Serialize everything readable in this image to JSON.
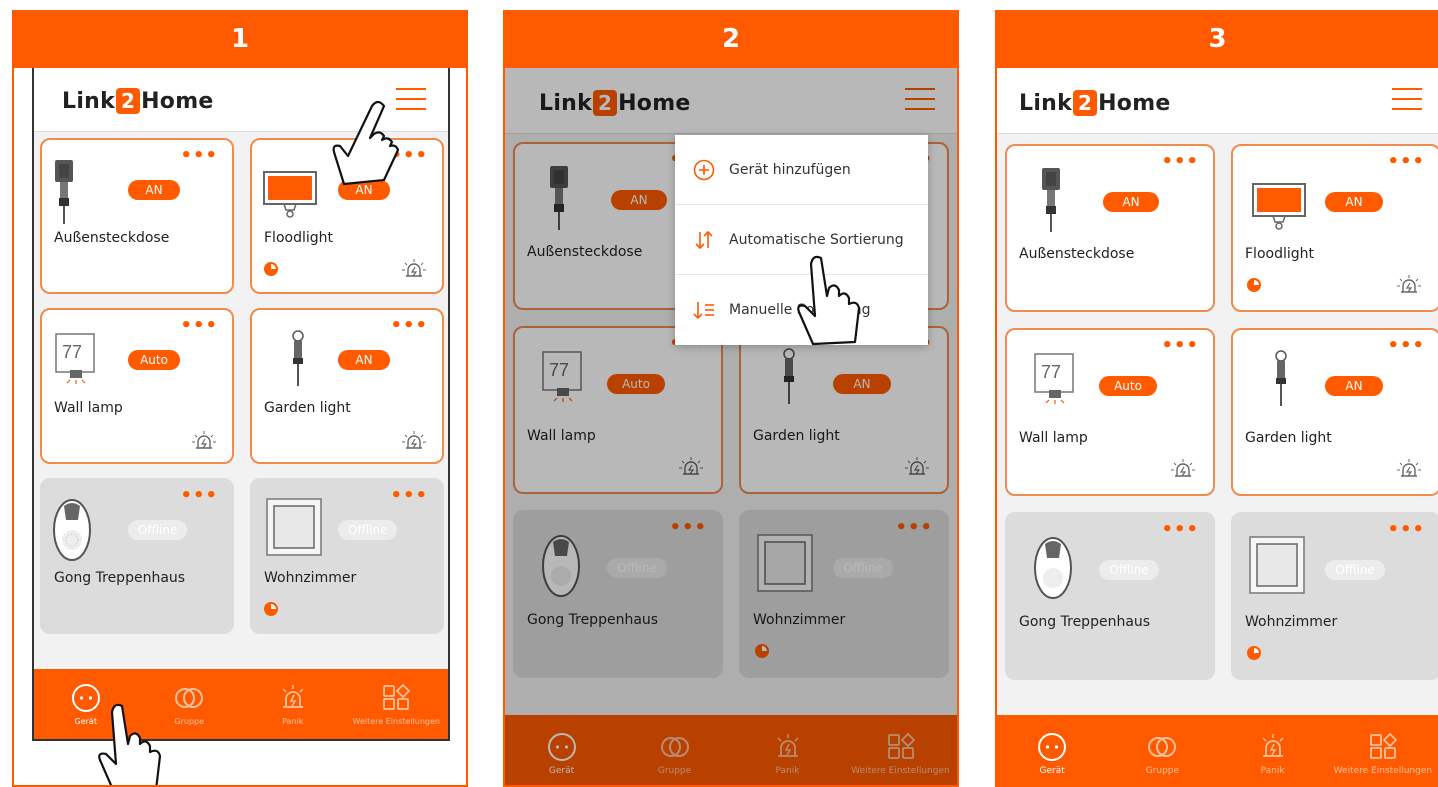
{
  "steps": [
    "1",
    "2",
    "3"
  ],
  "app": {
    "logo_pre": "Link",
    "logo_num": "2",
    "logo_post": "Home"
  },
  "devices": [
    {
      "name": "Außensteckdose",
      "badge": "AN"
    },
    {
      "name": "Floodlight",
      "badge": "AN"
    },
    {
      "name": "Wall lamp",
      "badge": "Auto"
    },
    {
      "name": "Garden light",
      "badge": "AN"
    },
    {
      "name": "Gong Treppenhaus",
      "badge": "Offline"
    },
    {
      "name": "Wohnzimmer",
      "badge": "Offline"
    }
  ],
  "wall_lamp_number": "77",
  "card_menu": "•••",
  "menu": {
    "add": "Gerät hinzufügen",
    "auto_sort": "Automatische Sortierung",
    "manual_sort": "Manuelle Sortierung"
  },
  "nav": [
    "Gerät",
    "Gruppe",
    "Panik",
    "Weitere Einstellungen"
  ],
  "colors": {
    "accent": "#ff5a00",
    "offline_card": "#dcdcdc"
  },
  "icons": [
    "menu-icon",
    "plug-icon",
    "floodlight-icon",
    "wall-lamp-icon",
    "garden-light-icon",
    "doorbell-icon",
    "switch-icon",
    "timer-pie-icon",
    "alarm-icon",
    "device-icon",
    "group-icon",
    "panic-icon",
    "settings-icon",
    "plus-circle-icon",
    "sort-auto-icon",
    "sort-manual-icon",
    "hand-pointer-icon"
  ]
}
